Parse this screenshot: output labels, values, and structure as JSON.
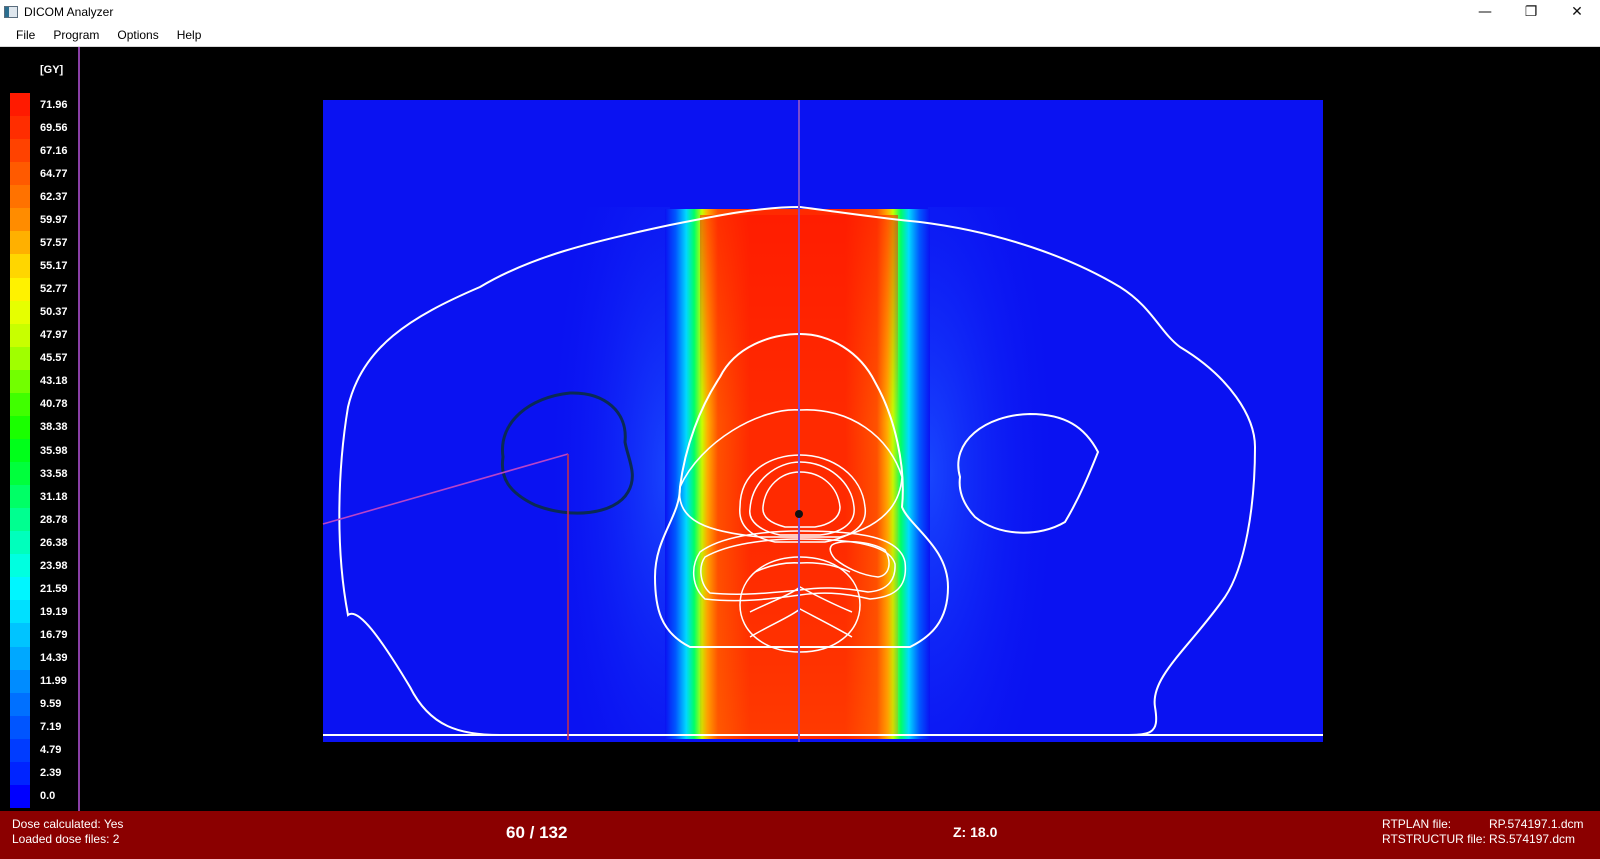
{
  "window": {
    "title": "DICOM Analyzer",
    "minimize_icon": "minimize-icon",
    "restore_icon": "restore-icon",
    "close_icon": "close-icon"
  },
  "menu": [
    "File",
    "Program",
    "Options",
    "Help"
  ],
  "legend": {
    "unit": "[GY]",
    "values": [
      "71.96",
      "69.56",
      "67.16",
      "64.77",
      "62.37",
      "59.97",
      "57.57",
      "55.17",
      "52.77",
      "50.37",
      "47.97",
      "45.57",
      "43.18",
      "40.78",
      "38.38",
      "35.98",
      "33.58",
      "31.18",
      "28.78",
      "26.38",
      "23.98",
      "21.59",
      "19.19",
      "16.79",
      "14.39",
      "11.99",
      "9.59",
      "7.19",
      "4.79",
      "2.39",
      "0.0"
    ],
    "colors": [
      "#ff1a00",
      "#ff2d00",
      "#ff4200",
      "#ff5a00",
      "#ff7200",
      "#ff8c00",
      "#ffb000",
      "#ffd600",
      "#fff200",
      "#e6ff00",
      "#c8ff00",
      "#a0ff00",
      "#72ff00",
      "#40ff00",
      "#1aff00",
      "#00ff1a",
      "#00ff3c",
      "#00ff66",
      "#00ff90",
      "#00ffbc",
      "#00ffe0",
      "#00f6ff",
      "#00e0ff",
      "#00c4ff",
      "#00a8ff",
      "#008cff",
      "#0070ff",
      "#0055ff",
      "#003cff",
      "#0024ff",
      "#0000ff"
    ]
  },
  "viewer": {
    "background_color": "#0a12f2",
    "crosshair_color": "#7a4ccf",
    "contour_color": "#ffffff",
    "dark_contour_color": "#0a2a55",
    "marker_color": "#b844c8"
  },
  "status": {
    "dose_calculated": "Dose calculated: Yes",
    "loaded_dose_files": "Loaded dose files: 2",
    "slice_counter": "60 / 132",
    "z": "Z: 18.0",
    "rtplan_label": "RTPLAN file:",
    "rtplan_value": "RP.574197.1.dcm",
    "rtstruct_label": "RTSTRUCTUR file:",
    "rtstruct_value": "RS.574197.dcm",
    "background_color": "#8b0000"
  }
}
